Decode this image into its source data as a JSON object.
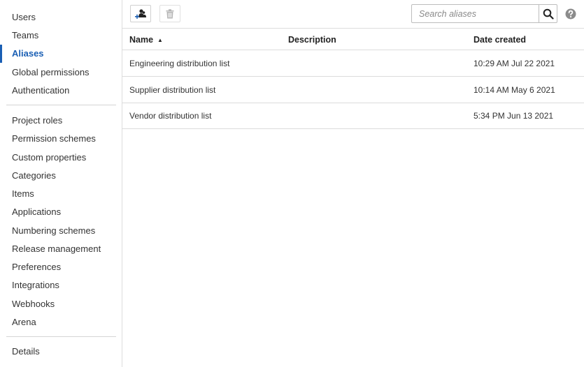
{
  "sidebar": {
    "group1": [
      "Users",
      "Teams",
      "Aliases",
      "Global permissions",
      "Authentication"
    ],
    "group2": [
      "Project roles",
      "Permission schemes",
      "Custom properties",
      "Categories",
      "Items",
      "Applications",
      "Numbering schemes",
      "Release management",
      "Preferences",
      "Integrations",
      "Webhooks",
      "Arena"
    ],
    "group3": [
      "Details"
    ],
    "active": "Aliases"
  },
  "search": {
    "placeholder": "Search aliases"
  },
  "table": {
    "columns": [
      "Name",
      "Description",
      "Date created"
    ],
    "sort_indicator": "▲",
    "rows": [
      {
        "name": "Engineering distribution list",
        "description": "",
        "date": "10:29 AM Jul 22 2021"
      },
      {
        "name": "Supplier distribution list",
        "description": "",
        "date": "10:14 AM May 6 2021"
      },
      {
        "name": "Vendor distribution list",
        "description": "",
        "date": "5:34 PM Jun 13 2021"
      }
    ]
  },
  "colors": {
    "accent": "#1a5fb4",
    "border": "#dcdcdc",
    "text": "#333333"
  }
}
